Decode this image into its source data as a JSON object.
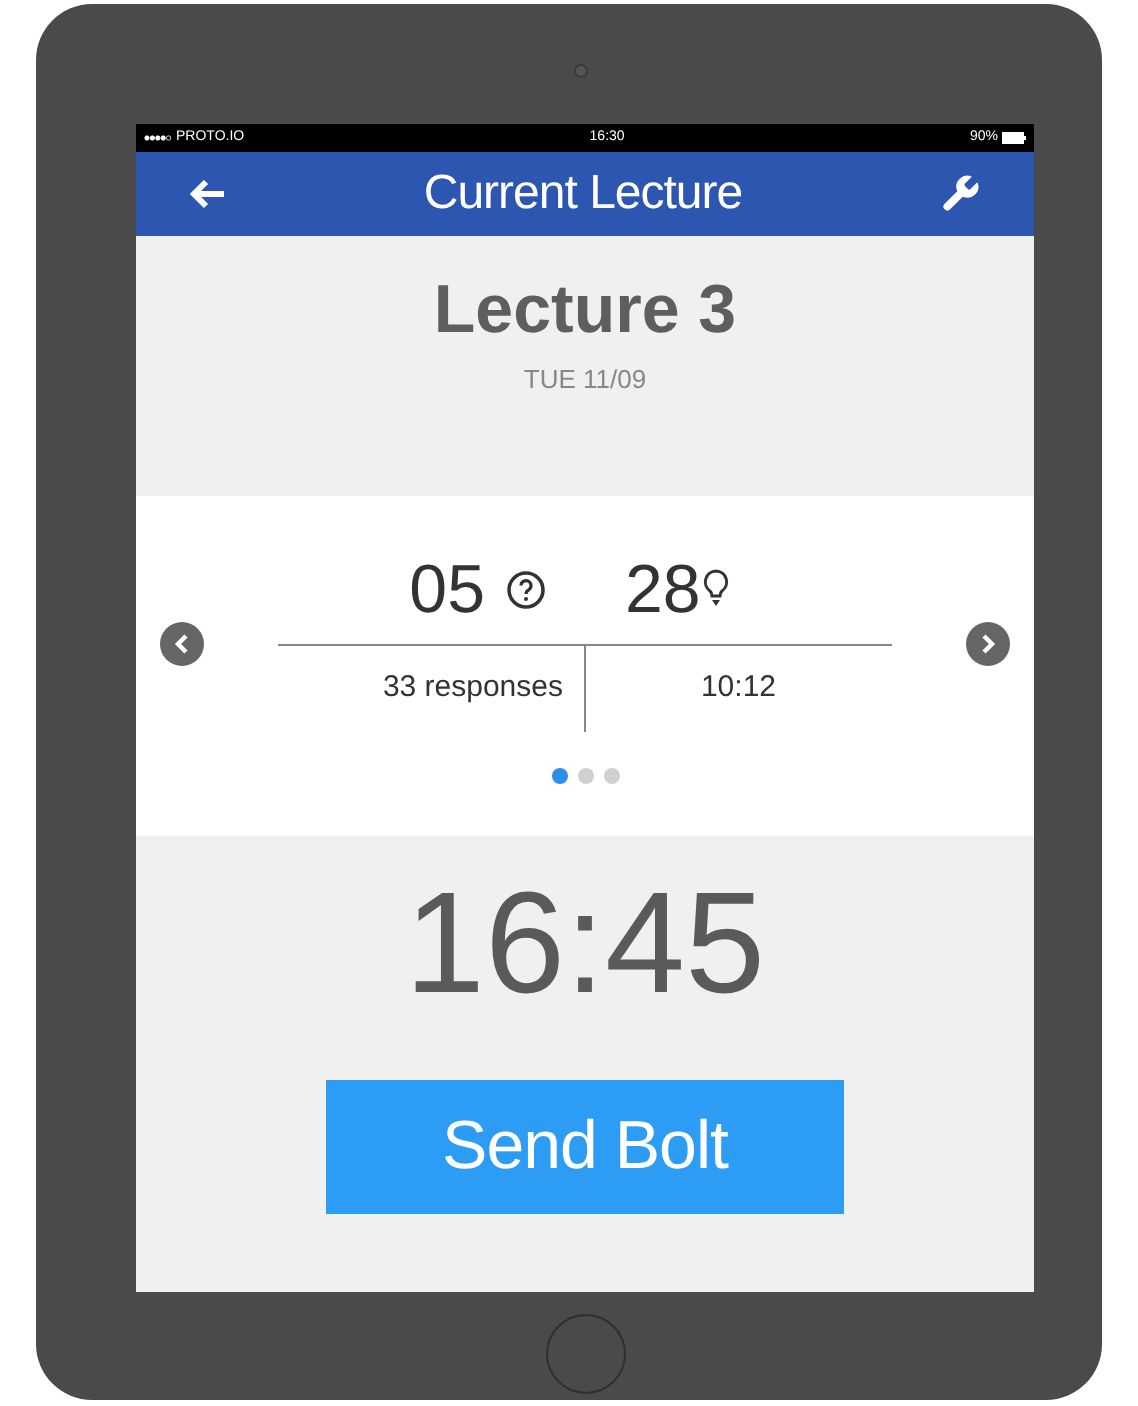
{
  "status_bar": {
    "carrier": "PROTO.IO",
    "time": "16:30",
    "battery": "90%"
  },
  "header": {
    "title": "Current Lecture"
  },
  "lecture": {
    "title": "Lecture 3",
    "date": "TUE 11/09"
  },
  "stats": {
    "questions": "05",
    "ideas": "28",
    "responses": "33 responses",
    "time": "10:12"
  },
  "pages": [
    {
      "selected": true
    },
    {
      "selected": false
    },
    {
      "selected": false
    }
  ],
  "timer": "16:45",
  "send_button": "Send Bolt"
}
